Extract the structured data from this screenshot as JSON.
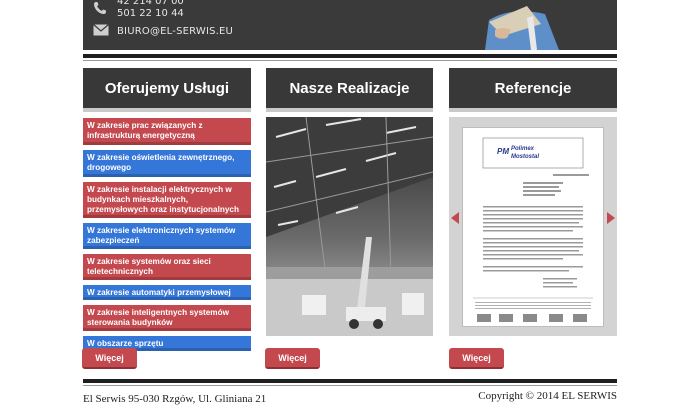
{
  "header": {
    "phone_lines": [
      "42 214 07 00",
      "501 22 10 44"
    ],
    "email": "BIURO@EL-SERWIS.EU"
  },
  "columns": {
    "services": {
      "title": "Oferujemy Usługi",
      "items": [
        {
          "label": "W zakresie prac związanych z infrastrukturą energetyczną",
          "color": "red"
        },
        {
          "label": "W zakresie oświetlenia zewnętrznego, drogowego",
          "color": "blue"
        },
        {
          "label": "W zakresie instalacji elektrycznych w budynkach mieszkalnych, przemysłowych oraz instytucjonalnych",
          "color": "red"
        },
        {
          "label": "W zakresie elektronicznych systemów zabezpieczeń",
          "color": "blue"
        },
        {
          "label": "W zakresie systemów oraz sieci teletechnicznych",
          "color": "red"
        },
        {
          "label": "W zakresie automatyki przemysłowej",
          "color": "blue"
        },
        {
          "label": "W zakresie inteligentnych systemów sterowania budynków",
          "color": "red"
        },
        {
          "label": "W obszarze sprzętu",
          "color": "blue"
        }
      ],
      "button": "Więcej"
    },
    "projects": {
      "title": "Nasze Realizacje",
      "button": "Więcej"
    },
    "references": {
      "title": "Referencje",
      "button": "Więcej",
      "doc_logo": "Polimex Mostostal"
    }
  },
  "footer": {
    "address": "El Serwis 95-030 Rzgów, Ul. Gliniana 21",
    "copyright": "Copyright © 2014 EL SERWIS"
  },
  "colors": {
    "accent_red": "#c4494f",
    "accent_blue": "#3577d8",
    "header_dark": "#383838"
  }
}
